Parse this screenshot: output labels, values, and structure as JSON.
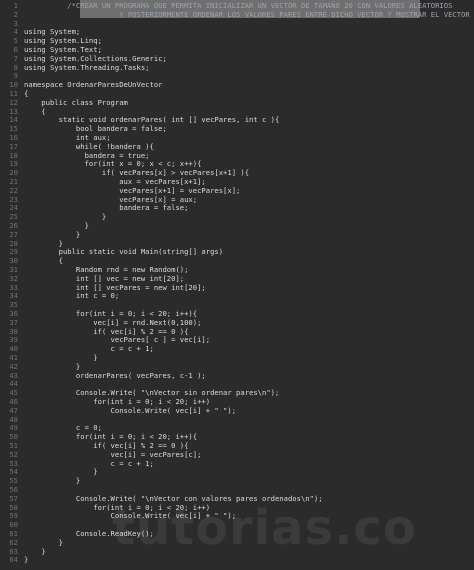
{
  "editor": {
    "lines": [
      {
        "n": "1",
        "text": "          /*CREAR UN PROGRAMA QUE PERMITA INICIALIZAR UN VECTOR DE TAMAÑO 20 CON VALORES ALEATORIOS"
      },
      {
        "n": "2",
        "text": "                      Y POSTERIORMENTE ORDENAR LOS VALORES PARES ENTRE DICHO VECTOR Y MOSTRAR EL VECTOR */"
      },
      {
        "n": "3",
        "text": ""
      },
      {
        "n": "4",
        "text": "using System;"
      },
      {
        "n": "5",
        "text": "using System.Linq;"
      },
      {
        "n": "6",
        "text": "using System.Text;"
      },
      {
        "n": "7",
        "text": "using System.Collections.Generic;"
      },
      {
        "n": "8",
        "text": "using System.Threading.Tasks;"
      },
      {
        "n": "9",
        "text": ""
      },
      {
        "n": "10",
        "text": "namespace OrdenarParesDeUnVector"
      },
      {
        "n": "11",
        "text": "{"
      },
      {
        "n": "12",
        "text": "    public class Program"
      },
      {
        "n": "13",
        "text": "    {"
      },
      {
        "n": "14",
        "text": "        static void ordenarPares( int [] vecPares, int c ){"
      },
      {
        "n": "15",
        "text": "            bool bandera = false;"
      },
      {
        "n": "16",
        "text": "            int aux;"
      },
      {
        "n": "17",
        "text": "            while( !bandera ){"
      },
      {
        "n": "18",
        "text": "              bandera = true;"
      },
      {
        "n": "19",
        "text": "              for(int x = 0; x < c; x++){"
      },
      {
        "n": "20",
        "text": "                  if( vecPares[x] > vecPares[x+1] ){"
      },
      {
        "n": "21",
        "text": "                      aux = vecPares[x+1];"
      },
      {
        "n": "22",
        "text": "                      vecPares[x+1] = vecPares[x];"
      },
      {
        "n": "23",
        "text": "                      vecPares[x] = aux;"
      },
      {
        "n": "24",
        "text": "                      bandera = false;"
      },
      {
        "n": "25",
        "text": "                  }"
      },
      {
        "n": "26",
        "text": "              }"
      },
      {
        "n": "27",
        "text": "            }"
      },
      {
        "n": "28",
        "text": "        }"
      },
      {
        "n": "29",
        "text": "        public static void Main(string[] args)"
      },
      {
        "n": "30",
        "text": "        {"
      },
      {
        "n": "31",
        "text": "            Random rnd = new Random();"
      },
      {
        "n": "32",
        "text": "            int [] vec = new int[20];"
      },
      {
        "n": "33",
        "text": "            int [] vecPares = new int[20];"
      },
      {
        "n": "34",
        "text": "            int c = 0;"
      },
      {
        "n": "35",
        "text": ""
      },
      {
        "n": "36",
        "text": "            for(int i = 0; i < 20; i++){"
      },
      {
        "n": "37",
        "text": "                vec[i] = rnd.Next(0,100);"
      },
      {
        "n": "38",
        "text": "                if( vec[i] % 2 == 0 ){"
      },
      {
        "n": "39",
        "text": "                    vecPares[ c ] = vec[i];"
      },
      {
        "n": "40",
        "text": "                    c = c + 1;"
      },
      {
        "n": "41",
        "text": "                }"
      },
      {
        "n": "42",
        "text": "            }"
      },
      {
        "n": "43",
        "text": "            ordenarPares( vecPares, c-1 );"
      },
      {
        "n": "44",
        "text": ""
      },
      {
        "n": "45",
        "text": "            Console.Write( \"\\nVector sin ordenar pares\\n\");"
      },
      {
        "n": "46",
        "text": "                for(int i = 0; i < 20; i++)"
      },
      {
        "n": "47",
        "text": "                    Console.Write( vec[i] + \" \");"
      },
      {
        "n": "48",
        "text": ""
      },
      {
        "n": "49",
        "text": "            c = 0;"
      },
      {
        "n": "50",
        "text": "            for(int i = 0; i < 20; i++){"
      },
      {
        "n": "51",
        "text": "                if( vec[i] % 2 == 0 ){"
      },
      {
        "n": "52",
        "text": "                    vec[i] = vecPares[c];"
      },
      {
        "n": "53",
        "text": "                    c = c + 1;"
      },
      {
        "n": "54",
        "text": "                }"
      },
      {
        "n": "55",
        "text": "            }"
      },
      {
        "n": "56",
        "text": ""
      },
      {
        "n": "57",
        "text": "            Console.Write( \"\\nVector con valores pares ordenados\\n\");"
      },
      {
        "n": "58",
        "text": "                for(int i = 0; i < 20; i++)"
      },
      {
        "n": "59",
        "text": "                    Console.Write( vec[i] + \" \");"
      },
      {
        "n": "60",
        "text": ""
      },
      {
        "n": "61",
        "text": "            Console.ReadKey();"
      },
      {
        "n": "62",
        "text": "        }"
      },
      {
        "n": "63",
        "text": "    }"
      },
      {
        "n": "64",
        "text": "}"
      }
    ]
  },
  "watermark": "tutorias.co",
  "colors": {
    "background": "#2b2b2b",
    "text": "#dcdcdc",
    "line_number": "#6f7379",
    "selection": "#a7a7a7"
  }
}
